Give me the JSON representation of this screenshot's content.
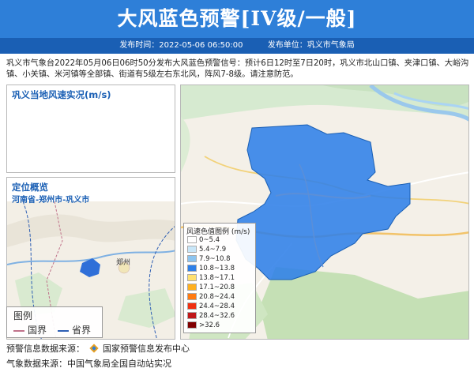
{
  "header": {
    "title": "大风蓝色预警[IV级/一般]"
  },
  "subbar": {
    "time": "发布时间：2022-05-06 06:50:00",
    "unit": "发布单位：巩义市气象局"
  },
  "description": "巩义市气象台2022年05月06日06时50分发布大风蓝色预警信号：预计6日12时至7日20时，巩义市北山口镇、夹津口镇、大峪沟镇、小关镇、米河镇等全部镇、街道有5级左右东北风，阵风7-8级。请注意防范。",
  "wind_panel": {
    "title": "巩义当地风速实况(m/s)"
  },
  "location_panel": {
    "title": "定位概览",
    "subtitle": "河南省-郑州市-巩义市",
    "city_label": "郑州"
  },
  "mini_legend": {
    "title": "图例",
    "items": [
      {
        "label": "国界",
        "color": "#c0728a"
      },
      {
        "label": "省界",
        "color": "#2e5fb4"
      }
    ]
  },
  "wind_legend": {
    "title": "风速色值图例 (m/s)",
    "items": [
      {
        "label": "0~5.4",
        "color": "#ffffff"
      },
      {
        "label": "5.4~7.9",
        "color": "#c8e6f8"
      },
      {
        "label": "7.9~10.8",
        "color": "#8cc4f0"
      },
      {
        "label": "10.8~13.8",
        "color": "#2f80e8"
      },
      {
        "label": "13.8~17.1",
        "color": "#ffe070"
      },
      {
        "label": "17.1~20.8",
        "color": "#ffb020"
      },
      {
        "label": "20.8~24.4",
        "color": "#ff7a10"
      },
      {
        "label": "24.4~28.4",
        "color": "#f03010"
      },
      {
        "label": "28.4~32.6",
        "color": "#c01818"
      },
      {
        "label": ">32.6",
        "color": "#800000"
      }
    ]
  },
  "footer": {
    "warning_source_label": "预警信息数据来源：",
    "warning_source_name": "国家预警信息发布中心",
    "weather_source": "气象数据来源：中国气象局全国自动站实况"
  }
}
